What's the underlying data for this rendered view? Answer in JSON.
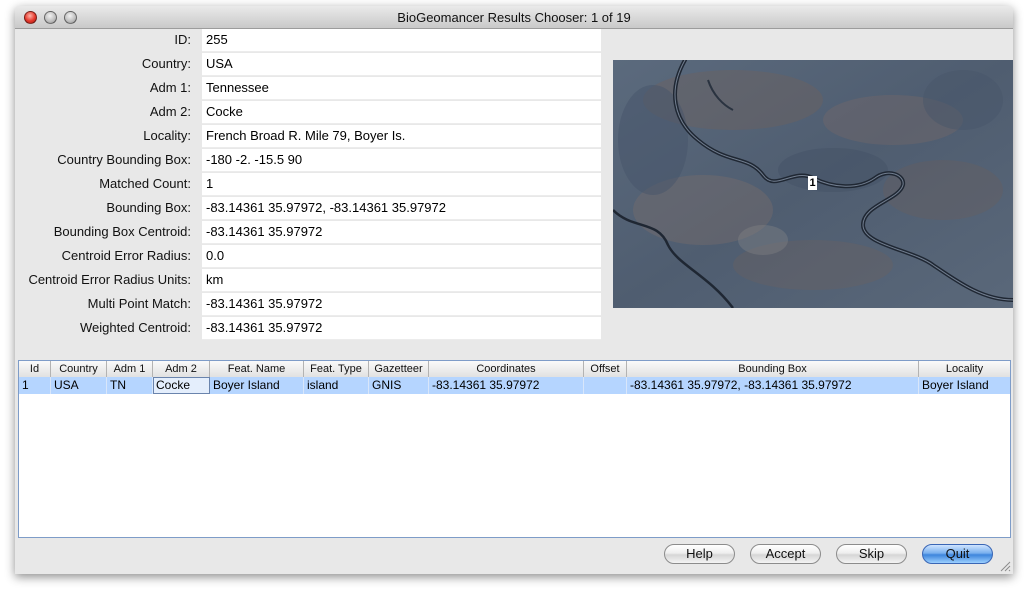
{
  "window": {
    "title": "BioGeomancer Results Chooser: 1 of 19"
  },
  "fields": [
    {
      "label": "ID:",
      "value": "255"
    },
    {
      "label": "Country:",
      "value": "USA"
    },
    {
      "label": "Adm 1:",
      "value": "Tennessee"
    },
    {
      "label": "Adm 2:",
      "value": "Cocke"
    },
    {
      "label": "Locality:",
      "value": "French Broad R. Mile 79, Boyer Is."
    },
    {
      "label": "Country Bounding Box:",
      "value": "-180 -2. -15.5 90"
    },
    {
      "label": "Matched Count:",
      "value": "1"
    },
    {
      "label": "Bounding Box:",
      "value": "-83.14361 35.97972, -83.14361 35.97972"
    },
    {
      "label": "Bounding Box Centroid:",
      "value": "-83.14361 35.97972"
    },
    {
      "label": "Centroid Error Radius:",
      "value": "0.0"
    },
    {
      "label": "Centroid Error Radius Units:",
      "value": "km"
    },
    {
      "label": "Multi Point Match:",
      "value": "-83.14361 35.97972"
    },
    {
      "label": "Weighted Centroid:",
      "value": "-83.14361 35.97972"
    }
  ],
  "map": {
    "marker_label": "1"
  },
  "table": {
    "columns": [
      "Id",
      "Country",
      "Adm 1",
      "Adm 2",
      "Feat. Name",
      "Feat. Type",
      "Gazetteer",
      "Coordinates",
      "Offset",
      "Bounding Box",
      "Locality"
    ],
    "rows": [
      [
        "1",
        "USA",
        "TN",
        "Cocke",
        "Boyer Island",
        "island",
        "GNIS",
        "-83.14361 35.97972",
        "",
        "-83.14361 35.97972, -83.14361 35.97972",
        "Boyer Island"
      ]
    ]
  },
  "buttons": {
    "help": "Help",
    "accept": "Accept",
    "skip": "Skip",
    "quit": "Quit"
  },
  "colors": {
    "selection": "#b5d5ff",
    "default_button": "#3e85dc",
    "table_border": "#7e9cc8"
  }
}
